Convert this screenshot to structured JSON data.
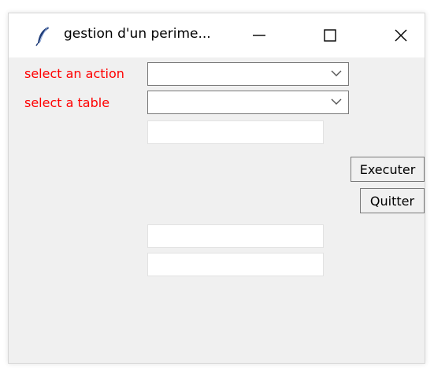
{
  "window": {
    "title": "gestion d'un perime...",
    "controls": {
      "minimize": "minimize-icon",
      "maximize": "maximize-icon",
      "close": "close-icon"
    }
  },
  "form": {
    "action_label": "select an action",
    "action_value": "",
    "table_label": "select a table",
    "table_value": "",
    "field1_value": "",
    "field2_value": "",
    "field3_value": ""
  },
  "buttons": {
    "execute": "Executer",
    "quit": "Quitter"
  },
  "colors": {
    "label": "#ff0000",
    "window_bg": "#f0f0f0",
    "titlebar_bg": "#ffffff"
  }
}
